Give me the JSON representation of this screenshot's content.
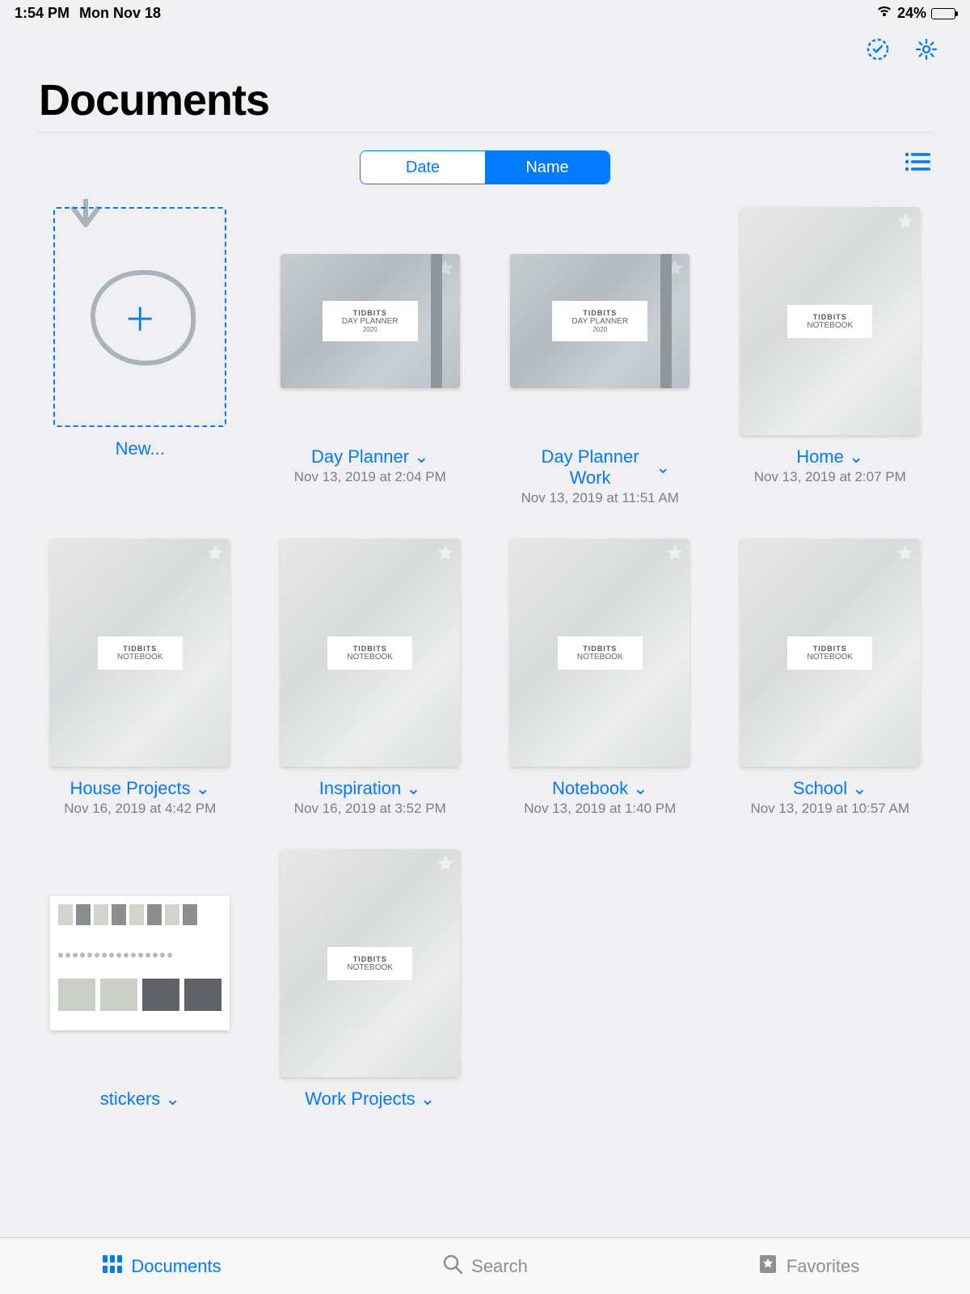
{
  "status": {
    "time": "1:54 PM",
    "date": "Mon Nov 18",
    "battery_pct": "24%"
  },
  "header": {
    "title": "Documents"
  },
  "segments": {
    "date": "Date",
    "name": "Name"
  },
  "new_label": "New...",
  "notebook_label": {
    "brand": "TIDBITS",
    "type": "NOTEBOOK"
  },
  "planner_label": {
    "brand": "TIDBITS",
    "type": "DAY PLANNER",
    "year": "2020"
  },
  "items": [
    {
      "title": "Day Planner",
      "date": "Nov 13, 2019 at 2:04 PM"
    },
    {
      "title": "Day Planner Work",
      "date": "Nov 13, 2019 at 11:51 AM"
    },
    {
      "title": "Home",
      "date": "Nov 13, 2019 at 2:07 PM"
    },
    {
      "title": "House Projects",
      "date": "Nov 16, 2019 at 4:42 PM"
    },
    {
      "title": "Inspiration",
      "date": "Nov 16, 2019 at 3:52 PM"
    },
    {
      "title": "Notebook",
      "date": "Nov 13, 2019 at 1:40 PM"
    },
    {
      "title": "School",
      "date": "Nov 13, 2019 at 10:57 AM"
    },
    {
      "title": "stickers",
      "date": ""
    },
    {
      "title": "Work Projects",
      "date": ""
    }
  ],
  "tabs": {
    "documents": "Documents",
    "search": "Search",
    "favorites": "Favorites"
  }
}
